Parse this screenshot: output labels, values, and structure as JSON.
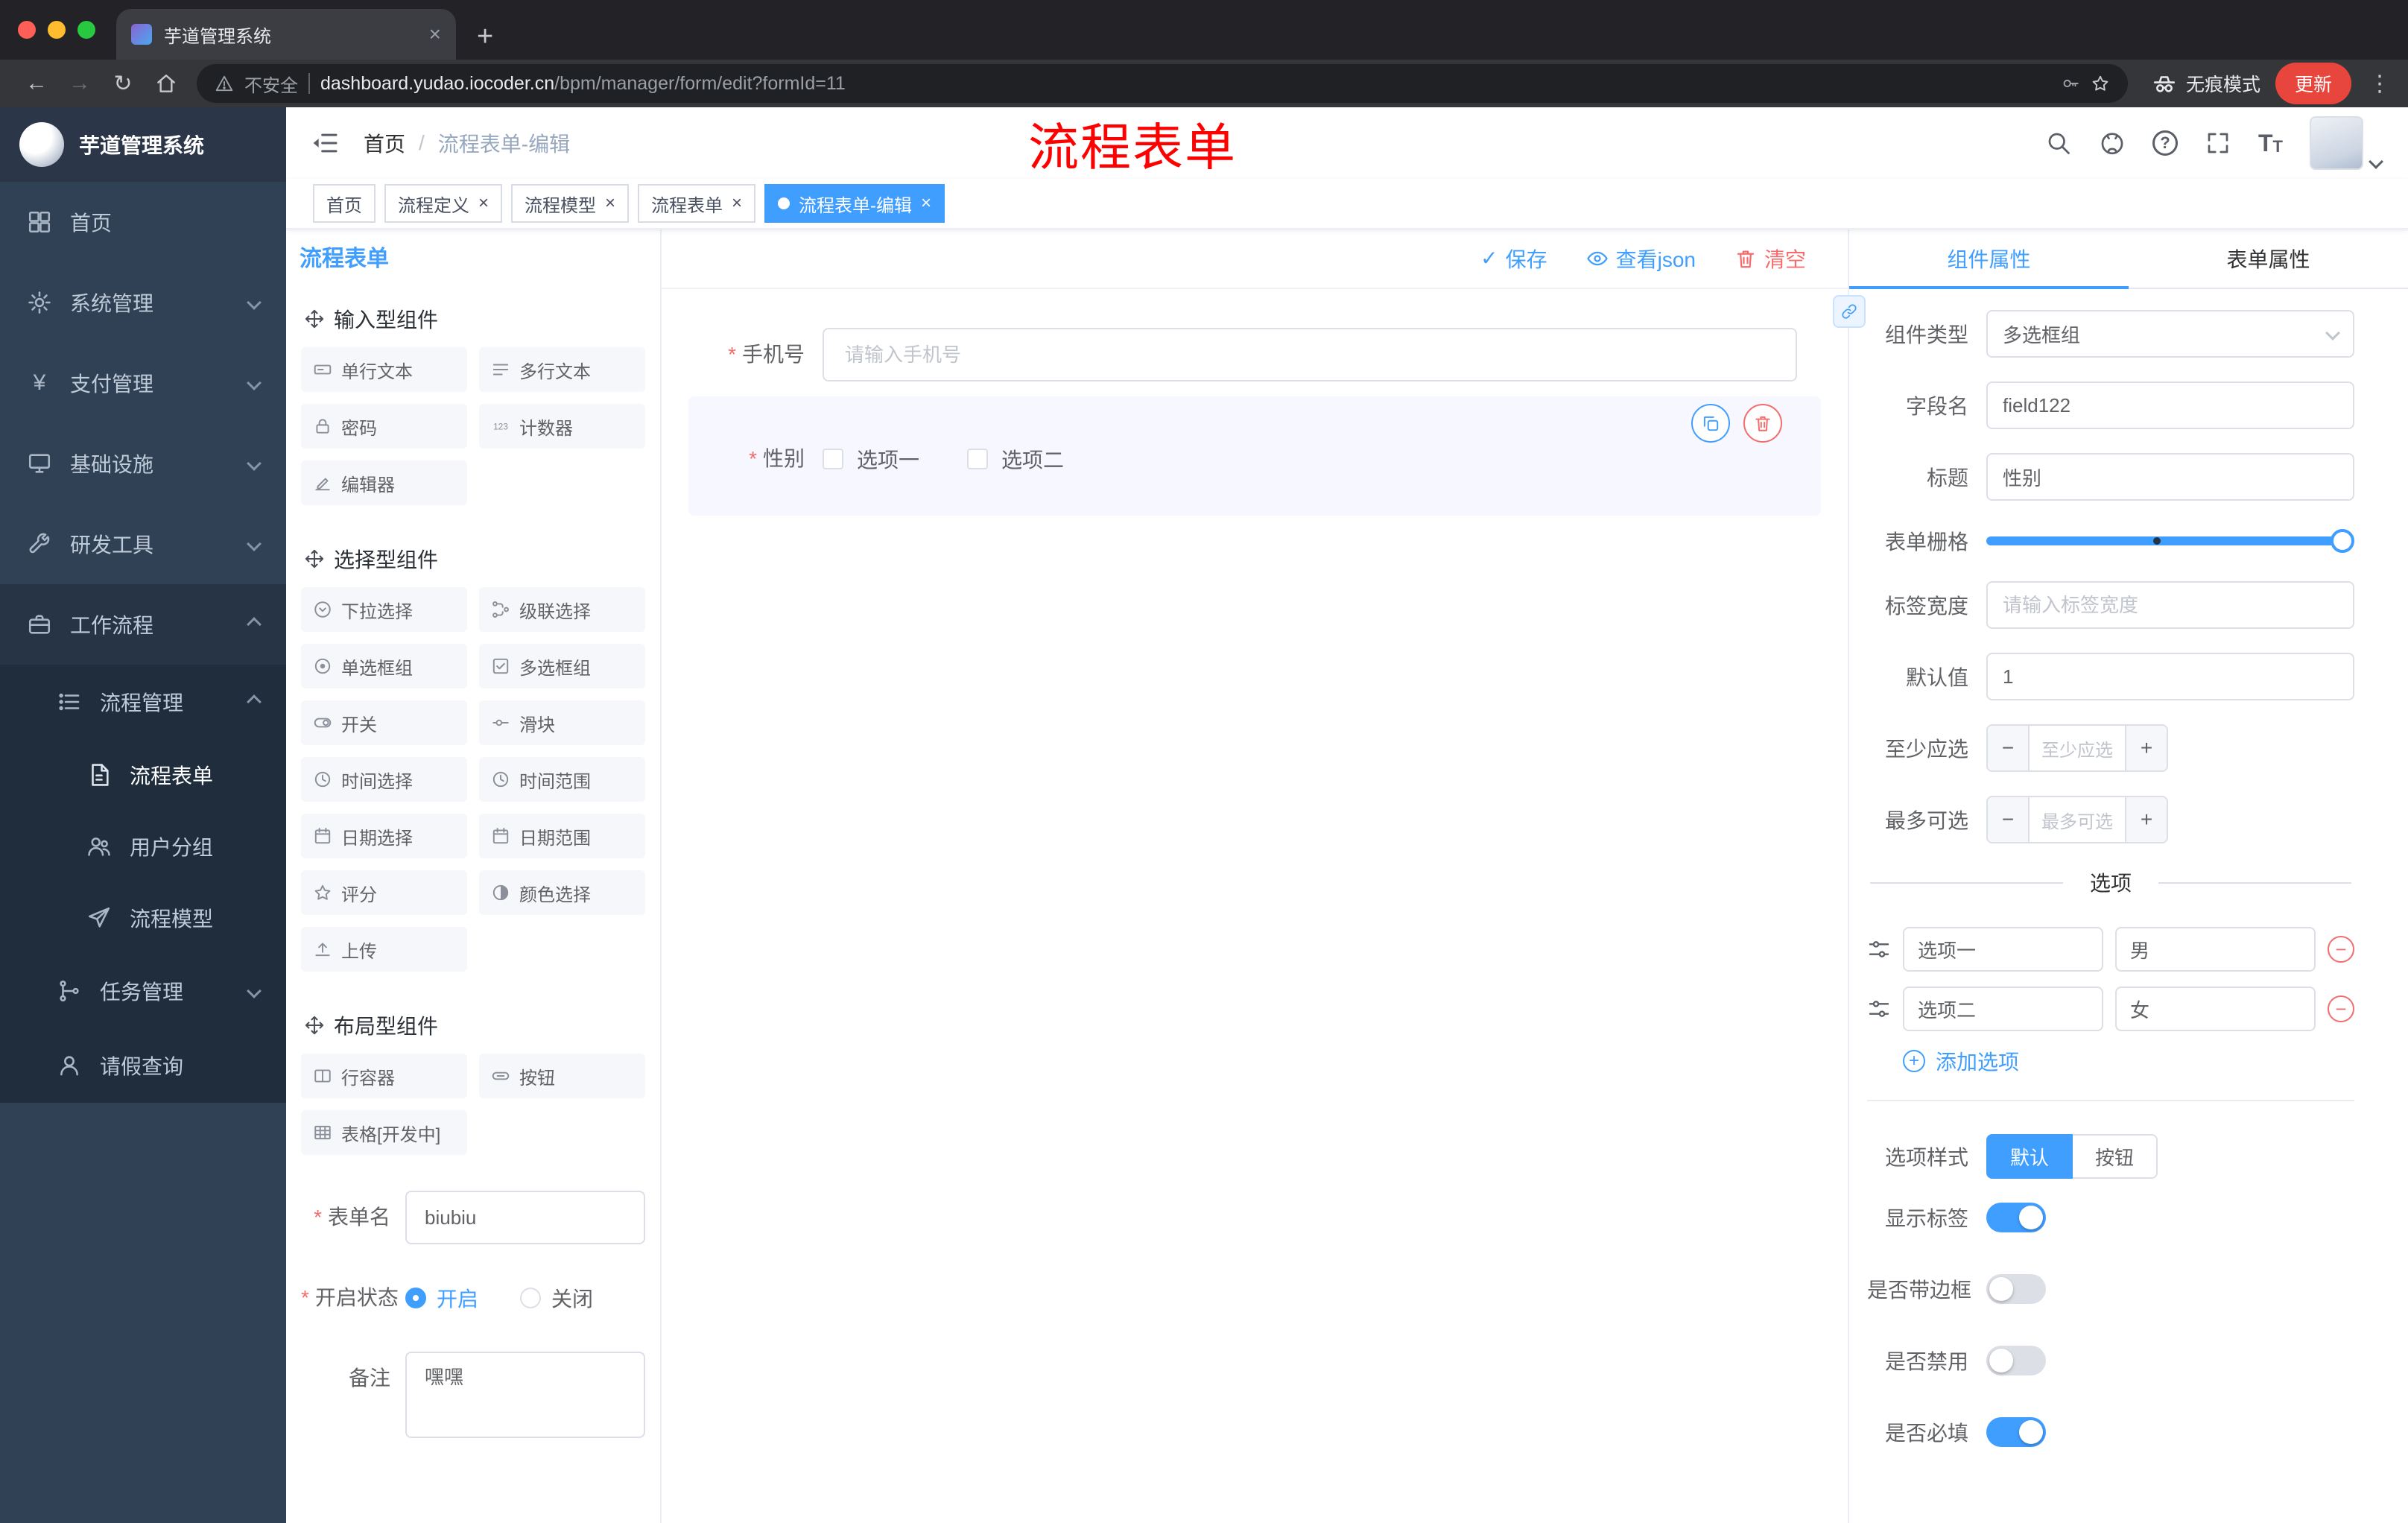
{
  "colors": {
    "accent": "#409EFF",
    "danger": "#F56C6C",
    "sidebar_bg": "#304156",
    "update_button": "#E8453C",
    "annotation_red": "#FF0000"
  },
  "icons": {
    "close": "×",
    "new_tab": "+",
    "back": "←",
    "forward": "→",
    "reload": "↻",
    "kebab": "⋮",
    "check": "✓",
    "question": "?",
    "yen": "¥",
    "plus": "+",
    "minus": "−",
    "slash": "/",
    "text_large": "T",
    "text_small": "T"
  },
  "browser": {
    "tab_title": "芋道管理系统",
    "security_label": "不安全",
    "url_host": "dashboard.yudao.iocoder.cn",
    "url_path": "/bpm/manager/form/edit?formId=11",
    "incognito_label": "无痕模式",
    "update_label": "更新"
  },
  "sidebar": {
    "title": "芋道管理系统",
    "items": [
      {
        "label": "首页"
      },
      {
        "label": "系统管理"
      },
      {
        "label": "支付管理"
      },
      {
        "label": "基础设施"
      },
      {
        "label": "研发工具"
      },
      {
        "label": "工作流程"
      }
    ],
    "process_mgmt": "流程管理",
    "process_children": [
      {
        "label": "流程表单"
      },
      {
        "label": "用户分组"
      },
      {
        "label": "流程模型"
      }
    ],
    "task_mgmt": "任务管理",
    "leave_query": "请假查询"
  },
  "header": {
    "breadcrumb_home": "首页",
    "breadcrumb_current": "流程表单-编辑",
    "annotation": "流程表单"
  },
  "tags": [
    {
      "label": "首页"
    },
    {
      "label": "流程定义"
    },
    {
      "label": "流程模型"
    },
    {
      "label": "流程表单"
    },
    {
      "label": "流程表单-编辑"
    }
  ],
  "palette": {
    "panel_title": "流程表单",
    "groups": [
      {
        "title": "输入型组件",
        "items": [
          {
            "label": "单行文本"
          },
          {
            "label": "多行文本"
          },
          {
            "label": "密码"
          },
          {
            "label": "计数器"
          },
          {
            "label": "编辑器"
          }
        ]
      },
      {
        "title": "选择型组件",
        "items": [
          {
            "label": "下拉选择"
          },
          {
            "label": "级联选择"
          },
          {
            "label": "单选框组"
          },
          {
            "label": "多选框组"
          },
          {
            "label": "开关"
          },
          {
            "label": "滑块"
          },
          {
            "label": "时间选择"
          },
          {
            "label": "时间范围"
          },
          {
            "label": "日期选择"
          },
          {
            "label": "日期范围"
          },
          {
            "label": "评分"
          },
          {
            "label": "颜色选择"
          },
          {
            "label": "上传"
          }
        ]
      },
      {
        "title": "布局型组件",
        "items": [
          {
            "label": "行容器"
          },
          {
            "label": "按钮"
          },
          {
            "label": "表格[开发中]"
          }
        ]
      }
    ],
    "form_meta": {
      "name_label": "表单名",
      "name_value": "biubiu",
      "status_label": "开启状态",
      "status_on": "开启",
      "status_off": "关闭",
      "remark_label": "备注",
      "remark_value": "嘿嘿"
    }
  },
  "canvas": {
    "save_label": "保存",
    "view_json_label": "查看json",
    "clear_label": "清空",
    "phone_label": "手机号",
    "phone_placeholder": "请输入手机号",
    "gender_label": "性别",
    "gender_option1": "选项一",
    "gender_option2": "选项二"
  },
  "props": {
    "tab_component": "组件属性",
    "tab_form": "表单属性",
    "type_label": "组件类型",
    "type_value": "多选框组",
    "field_label": "字段名",
    "field_value": "field122",
    "title_label": "标题",
    "title_value": "性别",
    "grid_label": "表单栅格",
    "label_width_label": "标签宽度",
    "label_width_placeholder": "请输入标签宽度",
    "default_label": "默认值",
    "default_value": "1",
    "min_label": "至少应选",
    "min_placeholder": "至少应选",
    "max_label": "最多可选",
    "max_placeholder": "最多可选",
    "options_title": "选项",
    "options": [
      {
        "label": "选项一",
        "value": "男"
      },
      {
        "label": "选项二",
        "value": "女"
      }
    ],
    "add_option": "添加选项",
    "style_label": "选项样式",
    "style_default": "默认",
    "style_button": "按钮",
    "toggles": [
      {
        "label": "显示标签",
        "on": true
      },
      {
        "label": "是否带边框",
        "on": false
      },
      {
        "label": "是否禁用",
        "on": false
      },
      {
        "label": "是否必填",
        "on": true
      }
    ]
  }
}
